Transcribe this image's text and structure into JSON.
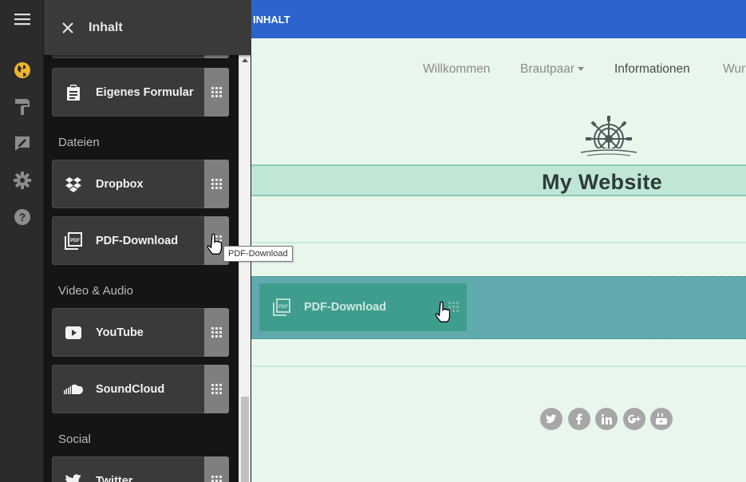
{
  "panel": {
    "title": "Inhalt",
    "sections": [
      {
        "label": "Dateien"
      },
      {
        "label": "Video & Audio"
      },
      {
        "label": "Social"
      }
    ],
    "widgets": [
      {
        "label": "Eigenes Formular",
        "icon": "form-icon"
      },
      {
        "label": "Dropbox",
        "icon": "dropbox-icon"
      },
      {
        "label": "PDF-Download",
        "icon": "pdf-icon"
      },
      {
        "label": "YouTube",
        "icon": "youtube-icon"
      },
      {
        "label": "SoundCloud",
        "icon": "soundcloud-icon"
      },
      {
        "label": "Twitter",
        "icon": "twitter-icon"
      }
    ]
  },
  "rail": {
    "icons": [
      "menu-icon",
      "globe-icon",
      "paint-roller-icon",
      "edit-icon",
      "gear-icon",
      "help-icon"
    ]
  },
  "topbar": {
    "title": "INHALT"
  },
  "nav": {
    "items": [
      {
        "label": "Willkommen"
      },
      {
        "label": "Brautpaar"
      },
      {
        "label": "Informationen"
      },
      {
        "label": "Wur"
      }
    ]
  },
  "site": {
    "title": "My Website"
  },
  "drag": {
    "ghost_label": "PDF-Download",
    "tooltip": "PDF-Download"
  },
  "social": {
    "icons": [
      "twitter-icon",
      "facebook-icon",
      "linkedin-icon",
      "google-plus-icon",
      "youtube-icon"
    ]
  },
  "colors": {
    "topbar": "#2b64cc",
    "accent_globe": "#f0b429",
    "panel_bg": "#151515",
    "rail_bg": "#2b2b2b",
    "content_bg": "#e8f6ec",
    "drop_zone": "#60a9ac",
    "banner": "#c0e6d6"
  }
}
